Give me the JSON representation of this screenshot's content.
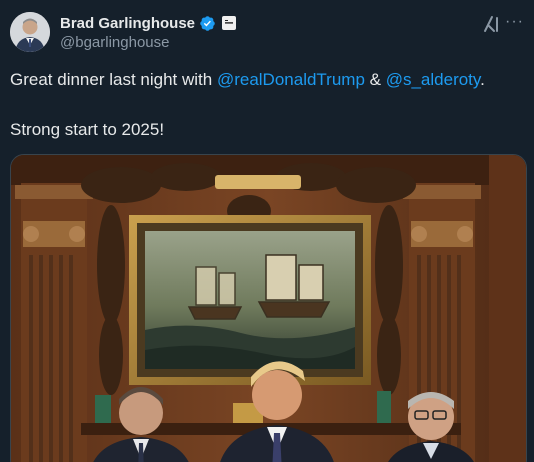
{
  "author": {
    "display_name": "Brad Garlinghouse",
    "handle": "@bgarlinghouse",
    "verified_icon": "verified-badge-icon",
    "affiliation_icon": "affiliate-badge-icon",
    "avatar_icon": "profile-photo"
  },
  "actions": {
    "grok_icon": "grok-icon",
    "more_label": "···"
  },
  "tweet": {
    "line1_prefix": "Great dinner last night with ",
    "mention1": "@realDonaldTrump",
    "line1_middle": " & ",
    "mention2": "@s_alderoty",
    "line1_suffix": ".",
    "line2": "Strong start to 2025!"
  },
  "media": {
    "type": "photo",
    "subject": "dinner-photo"
  },
  "colors": {
    "background": "#15202b",
    "text": "#e7e9ea",
    "secondary": "#8b98a5",
    "link": "#1d9bf0",
    "verified": "#1d9bf0"
  }
}
